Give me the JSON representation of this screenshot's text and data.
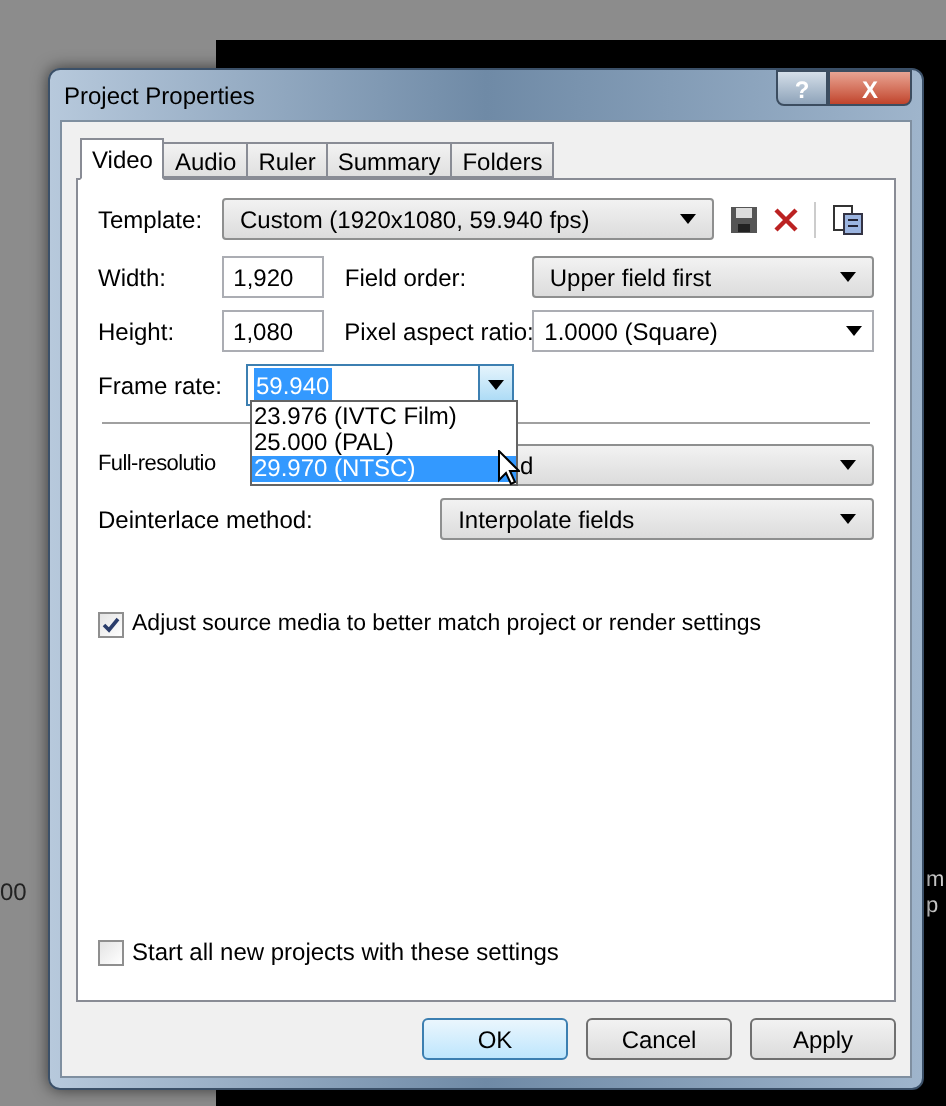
{
  "background": {
    "fragments": [
      "00",
      "m",
      "p"
    ]
  },
  "window": {
    "title": "Project Properties"
  },
  "title_buttons": [
    {
      "kind": "help",
      "label": "?"
    },
    {
      "kind": "close",
      "label": "X"
    }
  ],
  "tabs": [
    {
      "label": "Video",
      "selected": true
    },
    {
      "label": "Audio",
      "selected": false
    },
    {
      "label": "Ruler",
      "selected": false
    },
    {
      "label": "Summary",
      "selected": false
    },
    {
      "label": "Folders",
      "selected": false
    }
  ],
  "template": {
    "label": "Template:",
    "value": "Custom (1920x1080, 59.940 fps)"
  },
  "width": {
    "label": "Width:",
    "value": "1,920"
  },
  "height": {
    "label": "Height:",
    "value": "1,080"
  },
  "field_order": {
    "label": "Field order:",
    "value": "Upper field first"
  },
  "pixel_aspect_ratio": {
    "label": "Pixel aspect ratio:",
    "value": "1.0000 (Square)"
  },
  "frame_rate": {
    "label": "Frame rate:",
    "value": "59.940",
    "options": [
      {
        "label": "23.976 (IVTC Film)",
        "selected": false
      },
      {
        "label": "25.000 (PAL)",
        "selected": false
      },
      {
        "label": "29.970 (NTSC)",
        "selected": true
      }
    ]
  },
  "full_resolution": {
    "label": "Full-resolutio",
    "value": "d"
  },
  "deinterlace": {
    "label": "Deinterlace method:",
    "value": "Interpolate fields"
  },
  "adjust_source": {
    "label": "Adjust source media to better match project or render settings",
    "checked": true
  },
  "start_all_new": {
    "label": "Start all new projects with these settings",
    "checked": false
  },
  "buttons": [
    {
      "label": "OK",
      "default": true
    },
    {
      "label": "Cancel",
      "default": false
    },
    {
      "label": "Apply",
      "default": false
    }
  ]
}
